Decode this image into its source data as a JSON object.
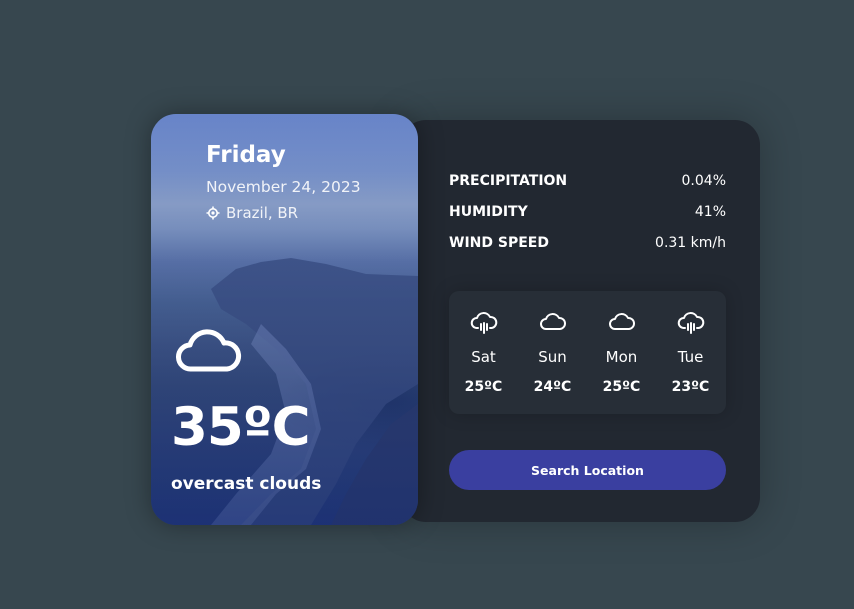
{
  "weather": {
    "day": "Friday",
    "date": "November 24, 2023",
    "location": "Brazil, BR",
    "temperature": "35ºC",
    "description": "overcast clouds",
    "icon": "cloud-icon"
  },
  "stats": [
    {
      "label": "PRECIPITATION",
      "value": "0.04%"
    },
    {
      "label": "HUMIDITY",
      "value": "41%"
    },
    {
      "label": "WIND SPEED",
      "value": "0.31 km/h"
    }
  ],
  "forecast": [
    {
      "day": "Sat",
      "temp": "25ºC",
      "icon": "rain-cloud-icon"
    },
    {
      "day": "Sun",
      "temp": "24ºC",
      "icon": "cloud-icon"
    },
    {
      "day": "Mon",
      "temp": "25ºC",
      "icon": "cloud-icon"
    },
    {
      "day": "Tue",
      "temp": "23ºC",
      "icon": "rain-cloud-icon"
    }
  ],
  "search_button": "Search Location",
  "colors": {
    "background": "#37474f",
    "panel": "#222831",
    "forecast_box": "#272e37",
    "button": "#3a3fa0"
  }
}
